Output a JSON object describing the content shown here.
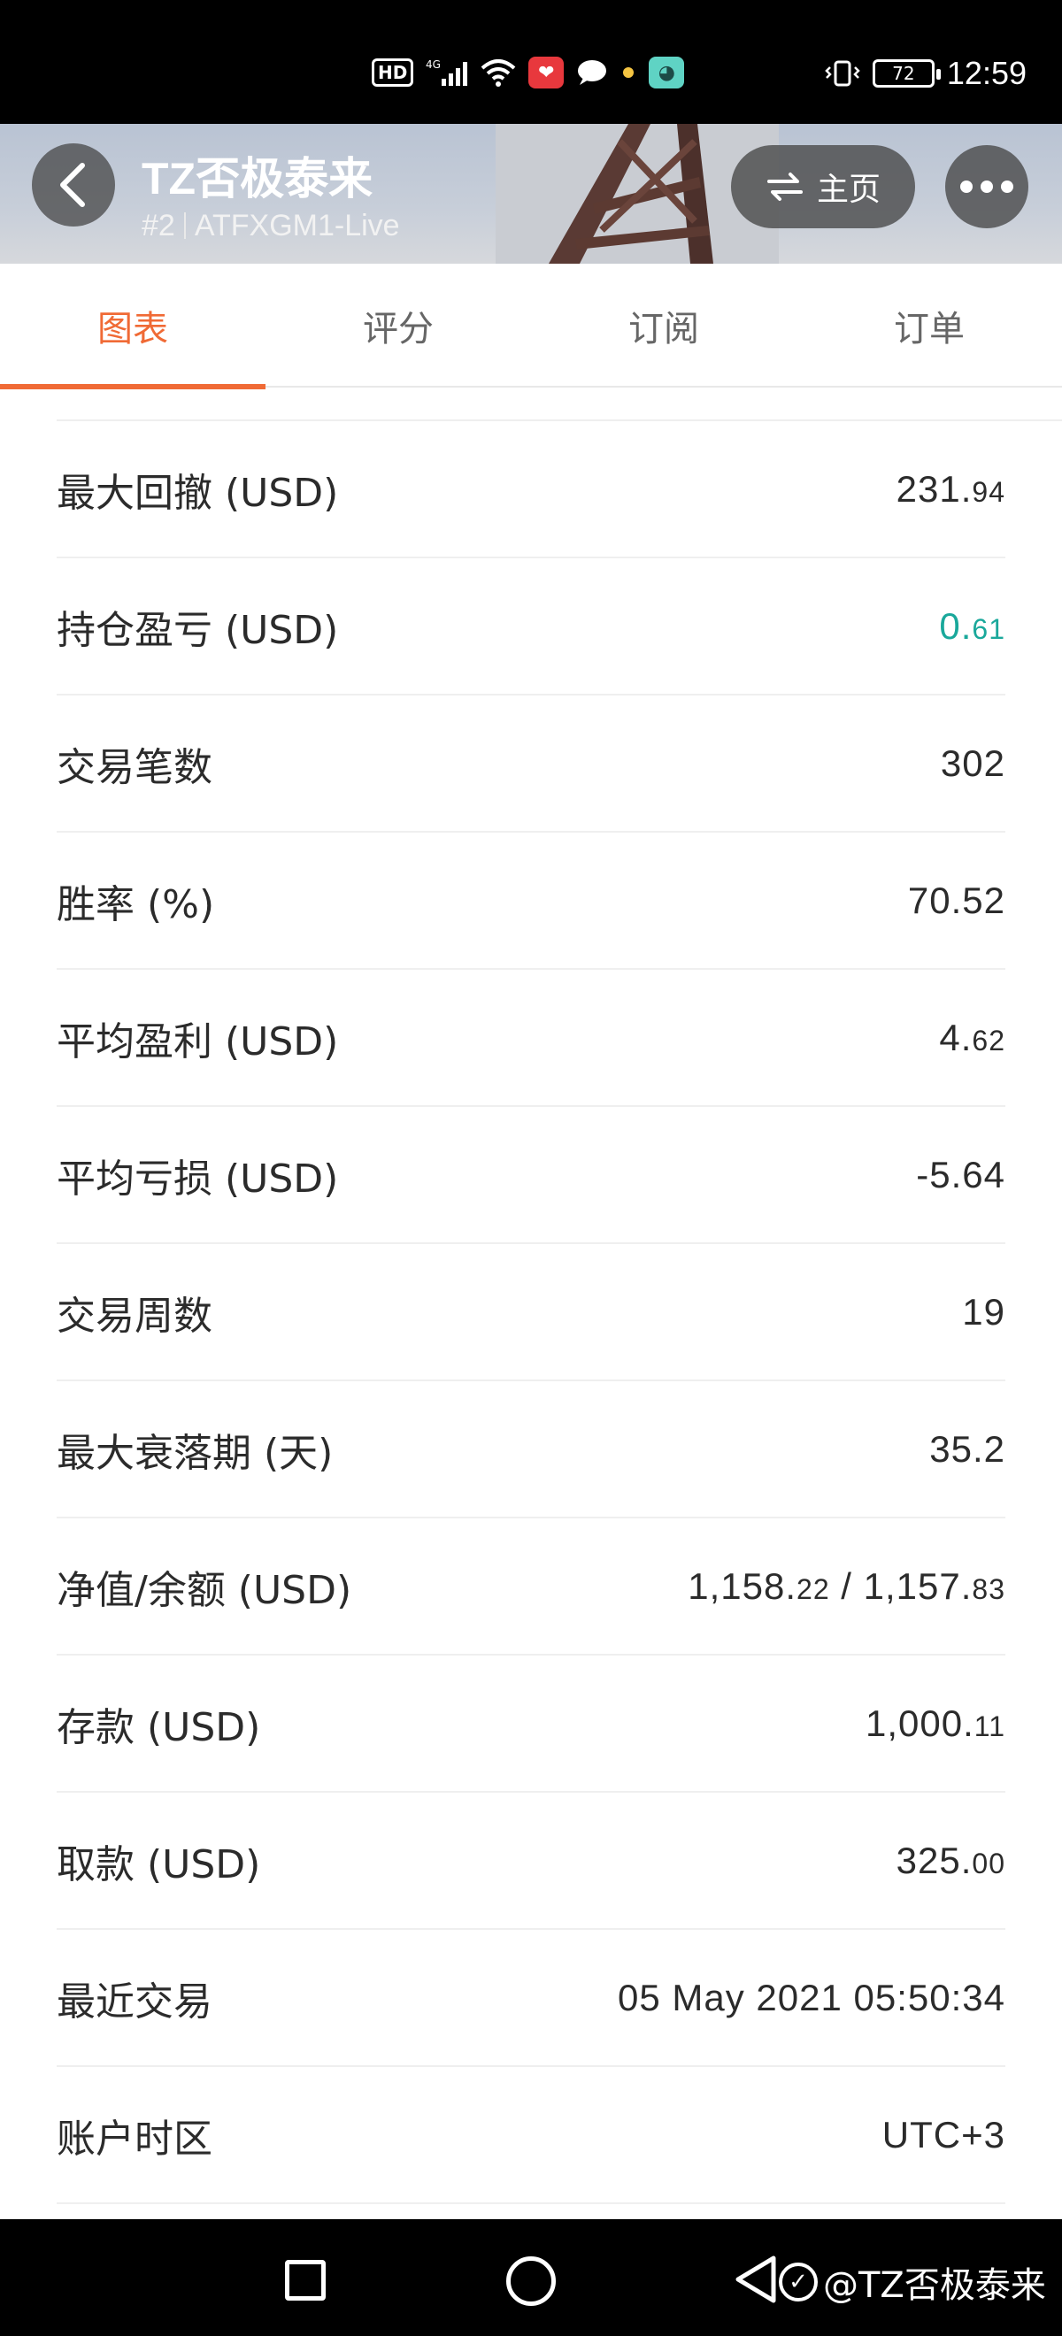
{
  "status_bar": {
    "time": "12:59",
    "battery": "72",
    "icons": [
      "hd-icon",
      "4g-signal-icon",
      "wifi-icon",
      "app-red-icon",
      "chat-icon",
      "dot-icon",
      "app-teal-icon",
      "vibrate-icon",
      "battery-icon"
    ],
    "hd_label": "HD"
  },
  "header": {
    "title": "TZ否极泰来",
    "rank": "#2",
    "account": "ATFXGM1-Live",
    "home_label": "主页"
  },
  "tabs": [
    {
      "label": "图表",
      "active": true
    },
    {
      "label": "评分",
      "active": false
    },
    {
      "label": "订阅",
      "active": false
    },
    {
      "label": "订单",
      "active": false
    }
  ],
  "stats": [
    {
      "label": "最大回撤 (USD)",
      "value_main": "231.",
      "value_small": "94",
      "color": "default"
    },
    {
      "label": "持仓盈亏 (USD)",
      "value_main": "0.",
      "value_small": "61",
      "color": "#1aa89b"
    },
    {
      "label": "交易笔数",
      "value_main": "302",
      "value_small": "",
      "color": "default"
    },
    {
      "label": "胜率 (%)",
      "value_main": "70.52",
      "value_small": "",
      "color": "default"
    },
    {
      "label": "平均盈利 (USD)",
      "value_main": "4.",
      "value_small": "62",
      "color": "default"
    },
    {
      "label": "平均亏损 (USD)",
      "value_main": "-5.64",
      "value_small": "",
      "color": "default"
    },
    {
      "label": "交易周数",
      "value_main": "19",
      "value_small": "",
      "color": "default"
    },
    {
      "label": "最大衰落期 (天)",
      "value_main": "35.2",
      "value_small": "",
      "color": "default"
    },
    {
      "label": "净值/余额 (USD)",
      "value_main": "1,158.",
      "value_small": "22",
      "value_main2": " / 1,157.",
      "value_small2": "83",
      "color": "default"
    },
    {
      "label": "存款 (USD)",
      "value_main": "1,000.",
      "value_small": "11",
      "color": "default"
    },
    {
      "label": "取款 (USD)",
      "value_main": "325.",
      "value_small": "00",
      "color": "default"
    },
    {
      "label": "最近交易",
      "value_main": "05 May 2021 05:50:34",
      "value_small": "",
      "color": "default"
    },
    {
      "label": "账户时区",
      "value_main": "UTC+3",
      "value_small": "",
      "color": "default"
    }
  ],
  "colors": {
    "accent": "#f06a35",
    "positive": "#1aa89b",
    "text": "#2b2b2b"
  },
  "watermark": "@TZ否极泰来"
}
